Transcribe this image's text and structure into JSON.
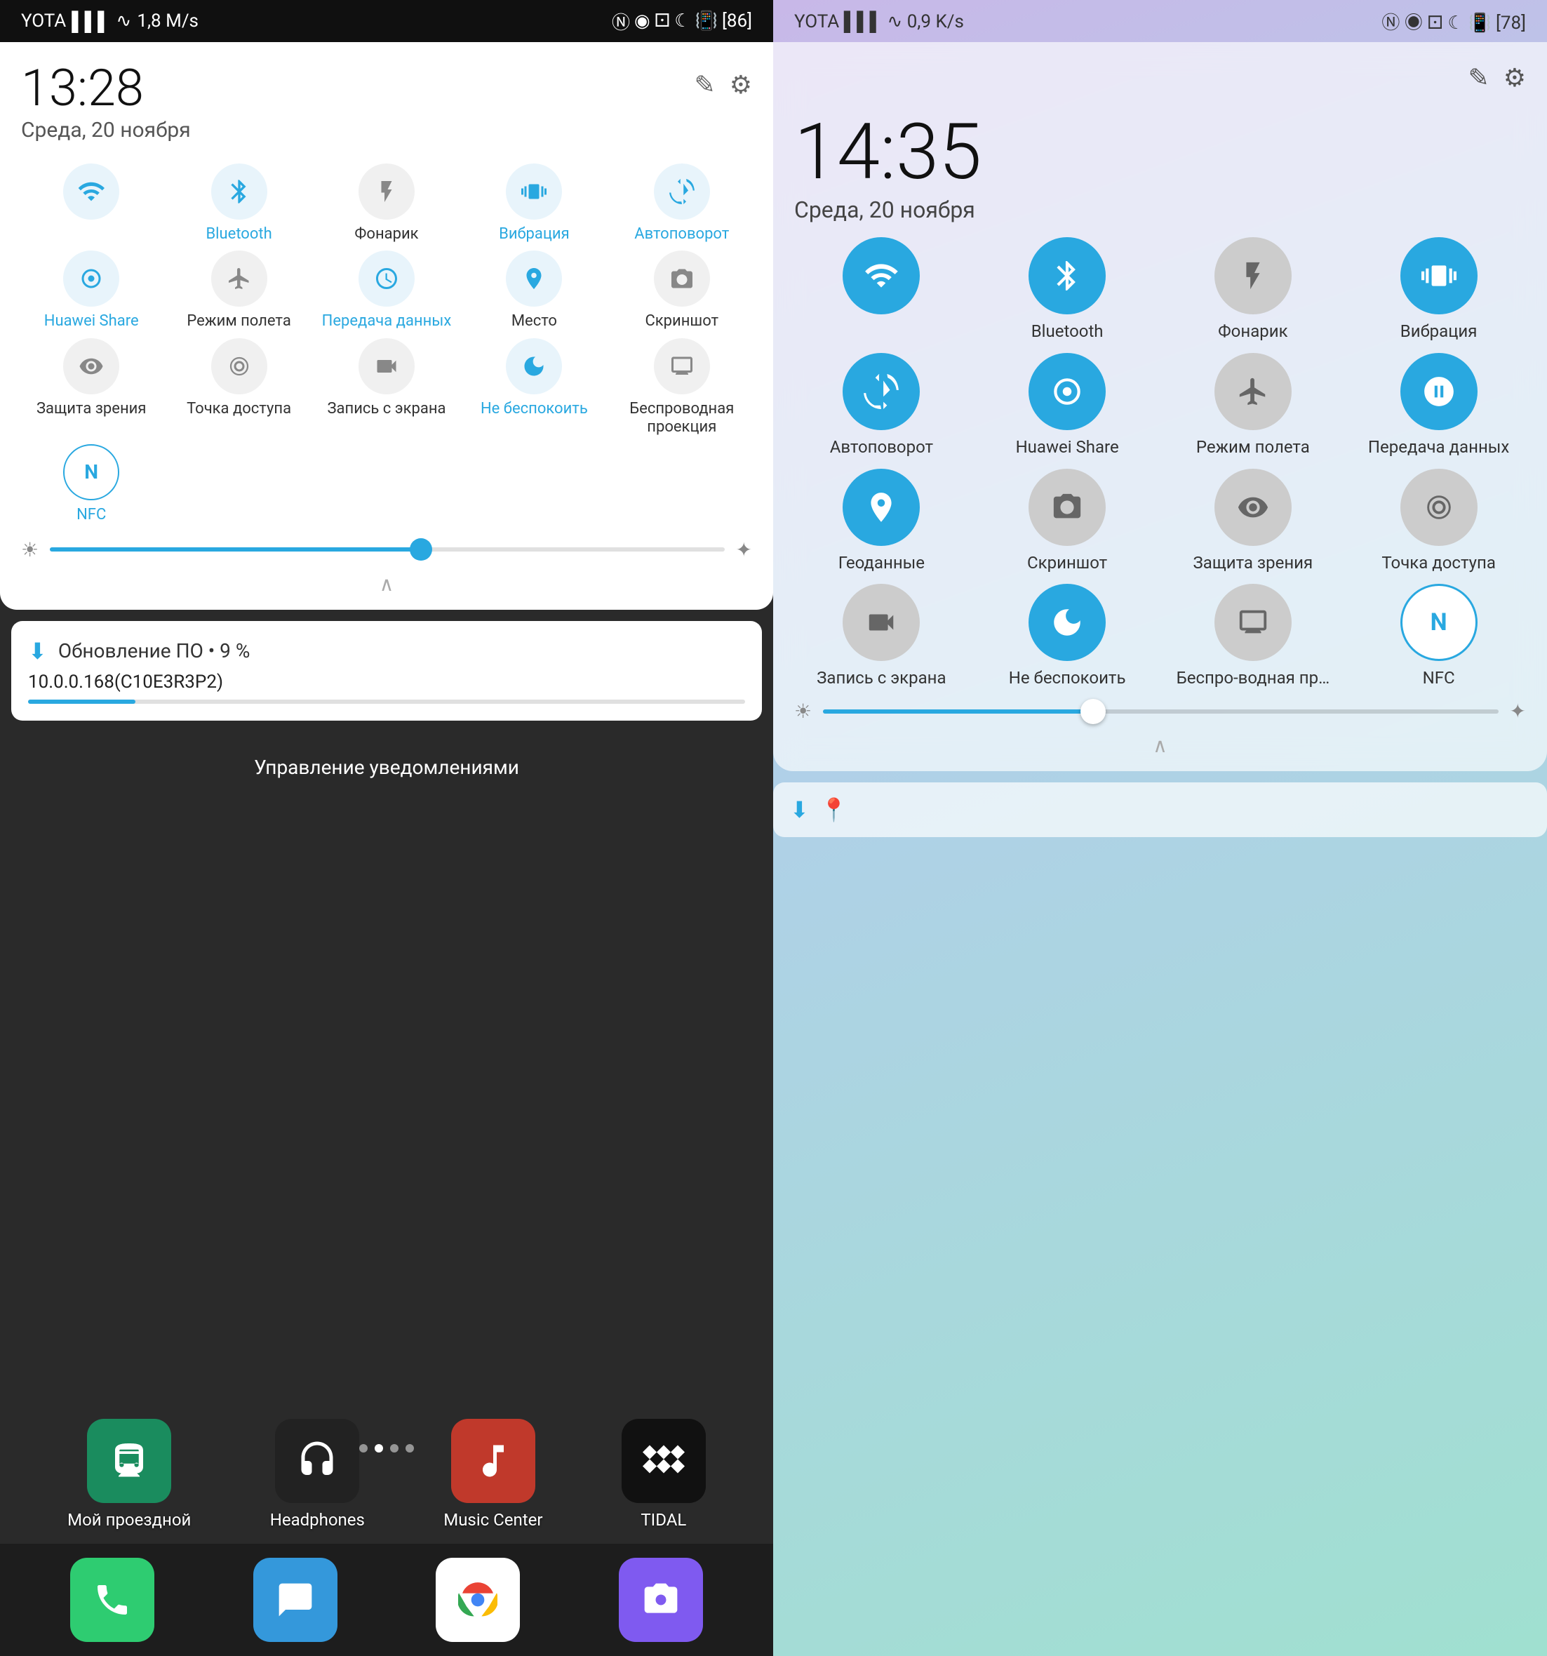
{
  "left_phone": {
    "status_bar": {
      "carrier": "YOTA",
      "signal": "▌▌▌",
      "wifi": "WiFi",
      "speed": "1,8 M/s",
      "battery": "86",
      "icons_right": "NFC BT alarm moon vibrate battery"
    },
    "time": "13:28",
    "date": "Среда, 20 ноября",
    "edit_icon": "✎",
    "settings_icon": "⚙",
    "tiles": [
      {
        "id": "wifi",
        "icon": "📶",
        "label": "",
        "state": "active"
      },
      {
        "id": "bluetooth",
        "icon": "🔵",
        "label": "Bluetooth",
        "state": "active"
      },
      {
        "id": "flashlight",
        "icon": "🔦",
        "label": "Фонарик",
        "state": "inactive"
      },
      {
        "id": "vibration",
        "icon": "📳",
        "label": "Вибрация",
        "state": "active"
      },
      {
        "id": "autorotate",
        "icon": "🔄",
        "label": "Автоповорот",
        "state": "active"
      },
      {
        "id": "huawei-share",
        "icon": "⊙",
        "label": "Huawei Share",
        "state": "active"
      },
      {
        "id": "airplane",
        "icon": "✈",
        "label": "Режим полета",
        "state": "inactive"
      },
      {
        "id": "data-transfer",
        "icon": "①",
        "label": "Передача данных",
        "state": "active"
      },
      {
        "id": "location",
        "icon": "📍",
        "label": "Место",
        "state": "active"
      },
      {
        "id": "screenshot",
        "icon": "🖼",
        "label": "Скриншот",
        "state": "inactive"
      },
      {
        "id": "eye-protect",
        "icon": "👁",
        "label": "Защита зрения",
        "state": "inactive"
      },
      {
        "id": "hotspot",
        "icon": "⊙",
        "label": "Точка доступа",
        "state": "inactive"
      },
      {
        "id": "screen-record",
        "icon": "🎬",
        "label": "Запись с экрана",
        "state": "inactive"
      },
      {
        "id": "dnd",
        "icon": "🌙",
        "label": "Не беспокоить",
        "state": "active"
      },
      {
        "id": "wireless-proj",
        "icon": "📡",
        "label": "Беспроводная проекция",
        "state": "inactive"
      },
      {
        "id": "nfc",
        "icon": "N",
        "label": "NFC",
        "state": "active"
      }
    ],
    "brightness": 55,
    "notification": {
      "icon": "⬇",
      "title": "Обновление ПО • 9 %",
      "subtitle": "10.0.0.168(C10E3R3P2)",
      "progress": 9
    },
    "manage_notifications": "Управление уведомлениями",
    "home_apps": [
      {
        "id": "transport",
        "icon": "🚌",
        "label": "Мой проездной",
        "bg": "#1a8c5e"
      },
      {
        "id": "headphones",
        "icon": "🎧",
        "label": "Headphones",
        "bg": "#333"
      },
      {
        "id": "music-center",
        "icon": "🎵",
        "label": "Music Center",
        "bg": "#c0392b"
      },
      {
        "id": "tidal",
        "icon": "≋",
        "label": "TIDAL",
        "bg": "#111"
      }
    ],
    "dock_apps": [
      {
        "id": "phone",
        "icon": "📞",
        "bg": "#2ecc71"
      },
      {
        "id": "messages",
        "icon": "💬",
        "bg": "#3498db"
      },
      {
        "id": "chrome",
        "icon": "🌐",
        "bg": "#fff"
      },
      {
        "id": "camera",
        "icon": "📷",
        "bg": "#9b59b6"
      }
    ]
  },
  "right_phone": {
    "status_bar": {
      "carrier": "YOTA",
      "signal": "▌▌▌",
      "wifi": "WiFi",
      "speed": "0,9 K/s",
      "battery": "78",
      "icons_right": "NFC BT alarm moon vibrate battery"
    },
    "time": "14:35",
    "date": "Среда, 20 ноября",
    "edit_icon": "✎",
    "settings_icon": "⚙",
    "tiles": [
      {
        "id": "wifi",
        "icon": "📶",
        "label": "",
        "state": "active"
      },
      {
        "id": "bluetooth",
        "icon": "✱",
        "label": "Bluetooth",
        "state": "active"
      },
      {
        "id": "flashlight",
        "icon": "🔦",
        "label": "Фонарик",
        "state": "inactive"
      },
      {
        "id": "vibration",
        "icon": "📳",
        "label": "Вибрация",
        "state": "active"
      },
      {
        "id": "autorotate",
        "icon": "⟳",
        "label": "Автоповорот",
        "state": "active"
      },
      {
        "id": "huawei-share",
        "icon": "◉",
        "label": "Huawei Share",
        "state": "active"
      },
      {
        "id": "airplane",
        "icon": "✈",
        "label": "Режим полета",
        "state": "inactive"
      },
      {
        "id": "data-transfer",
        "icon": "Ⅱ",
        "label": "Передача данных",
        "state": "active"
      },
      {
        "id": "location",
        "icon": "⊙",
        "label": "Геоданные",
        "state": "active"
      },
      {
        "id": "screenshot",
        "icon": "✂",
        "label": "Скриншот",
        "state": "inactive"
      },
      {
        "id": "eye-protect",
        "icon": "👁",
        "label": "Защита зрения",
        "state": "inactive"
      },
      {
        "id": "hotspot",
        "icon": "◉",
        "label": "Точка доступа",
        "state": "inactive"
      },
      {
        "id": "screen-record",
        "icon": "⬛",
        "label": "Запись с экрана",
        "state": "inactive"
      },
      {
        "id": "dnd",
        "icon": "🌙",
        "label": "Не беспокоить",
        "state": "active"
      },
      {
        "id": "wireless-proj",
        "icon": "📡",
        "label": "Беспро-водная пр…",
        "state": "inactive"
      },
      {
        "id": "nfc",
        "icon": "N",
        "label": "NFC",
        "state": "active"
      }
    ],
    "brightness": 40,
    "bottom_notif": {
      "icon1": "⬇",
      "icon2": "📍"
    }
  }
}
